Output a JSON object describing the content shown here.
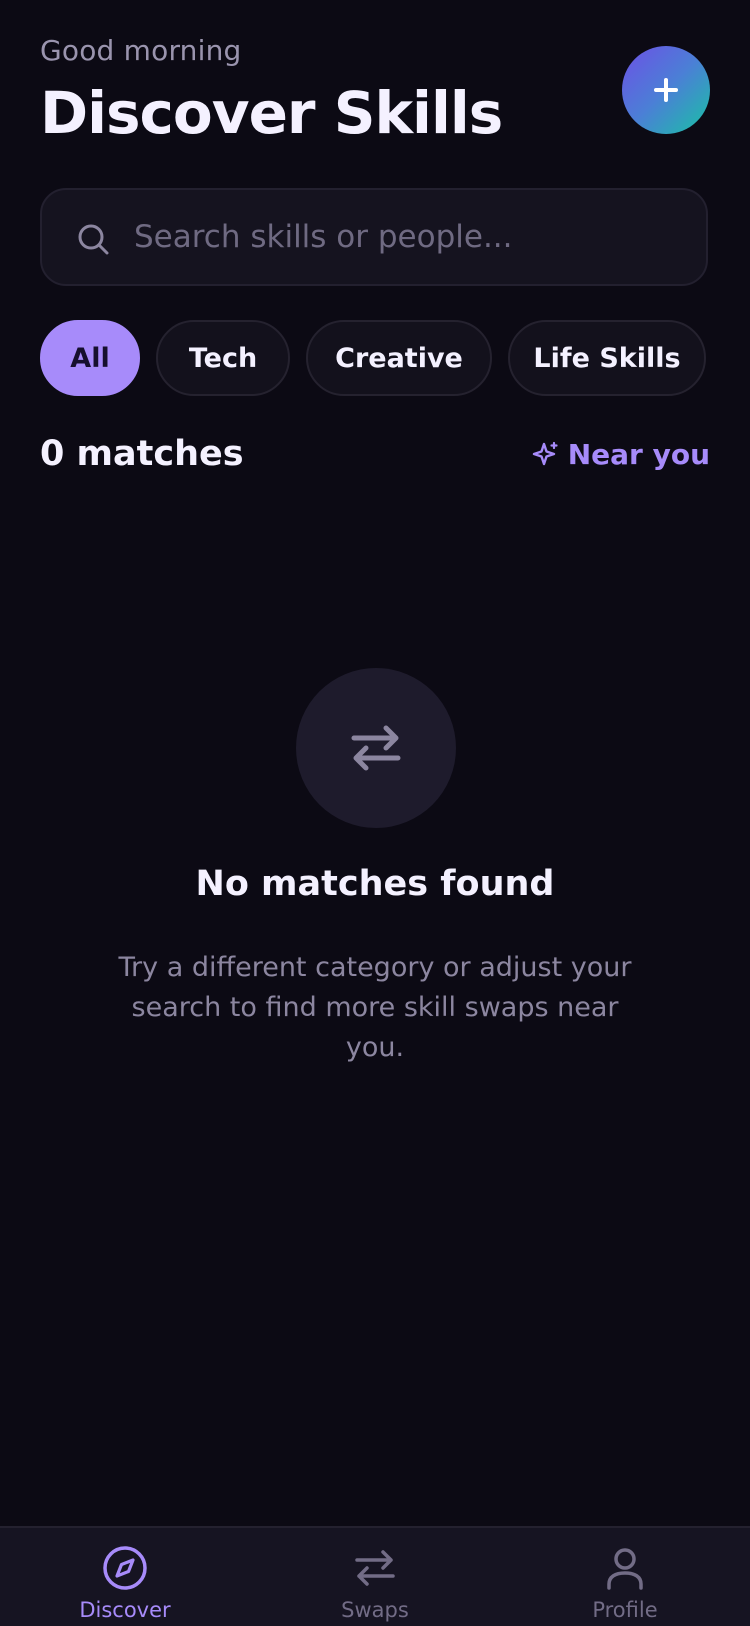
{
  "header": {
    "greeting": "Good morning",
    "title": "Discover Skills",
    "add_button_symbol": "+"
  },
  "search": {
    "placeholder": "Search skills or people...",
    "value": "",
    "icon": "search-icon"
  },
  "filters": {
    "chips": [
      {
        "label": "All",
        "active": true
      },
      {
        "label": "Tech",
        "active": false
      },
      {
        "label": "Creative",
        "active": false
      },
      {
        "label": "Life Skills",
        "active": false
      }
    ]
  },
  "results": {
    "count_label": "0 matches",
    "near_label": "Near you",
    "near_icon": "sparkle-icon"
  },
  "empty_state": {
    "icon": "swap-arrows-icon",
    "title": "No matches found",
    "message": "Try a different category or adjust your search to find more skill swaps near you."
  },
  "tabbar": {
    "items": [
      {
        "label": "Discover",
        "icon": "compass-icon",
        "active": true
      },
      {
        "label": "Swaps",
        "icon": "swap-arrows-icon",
        "active": false
      },
      {
        "label": "Profile",
        "icon": "user-icon",
        "active": false
      }
    ]
  },
  "colors": {
    "background": "#0c0a14",
    "accent": "#a78bfa",
    "surface": "#15131f",
    "muted_text": "#8c86a0"
  }
}
